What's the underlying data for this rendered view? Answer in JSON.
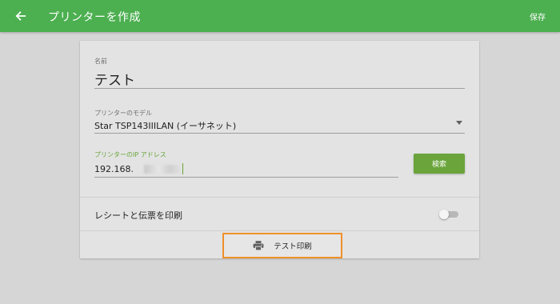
{
  "appbar": {
    "back_icon": "arrow-left-icon",
    "title": "プリンターを作成",
    "save_label": "保存",
    "color": "#4caf50"
  },
  "form": {
    "name": {
      "label": "名前",
      "value": "テスト"
    },
    "model": {
      "label": "プリンターのモデル",
      "value": "Star TSP143IIILAN (イーサネット)"
    },
    "ip": {
      "label": "プリンターのIP アドレス",
      "value": "192.168."
    },
    "search_label": "検索",
    "receipt_toggle": {
      "label": "レシートと伝票を印刷",
      "on": false
    },
    "test_print": {
      "icon": "printer-icon",
      "label": "テスト印刷"
    }
  },
  "colors": {
    "accent": "#6aa43a",
    "highlight_border": "#f0902a"
  }
}
